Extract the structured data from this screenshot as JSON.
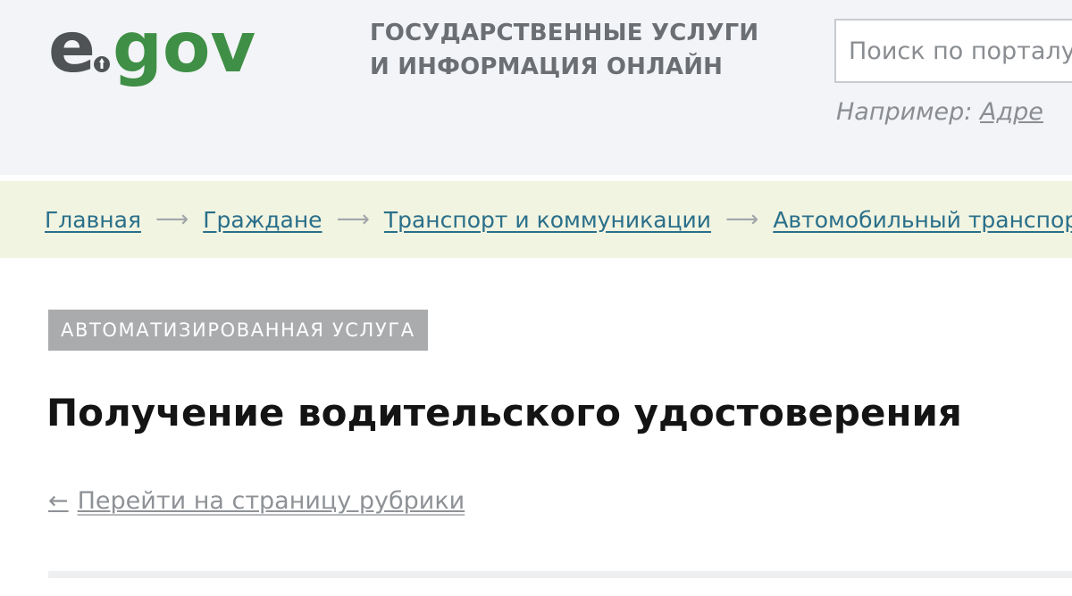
{
  "header": {
    "logo_text": "egov",
    "slogan_line1": "ГОСУДАРСТВЕННЫЕ УСЛУГИ",
    "slogan_line2": "И ИНФОРМАЦИЯ ОНЛАЙН",
    "colors": {
      "logo_gray": "#4f5356",
      "logo_green": "#3f8f46",
      "background": "#f3f4f7"
    }
  },
  "search": {
    "placeholder": "Поиск по порталу",
    "example_label": "Например:",
    "example_link": "Адре"
  },
  "breadcrumb": {
    "items": [
      {
        "label": "Главная"
      },
      {
        "label": "Граждане"
      },
      {
        "label": "Транспорт и коммуникации"
      },
      {
        "label": "Автомобильный транспорт"
      }
    ],
    "separator": "⟶"
  },
  "service": {
    "badge": "АВТОМАТИЗИРОВАННАЯ УСЛУГА",
    "title": "Получение водительского удостоверения",
    "back_arrow": "←",
    "back_link": "Перейти на страницу рубрики"
  }
}
